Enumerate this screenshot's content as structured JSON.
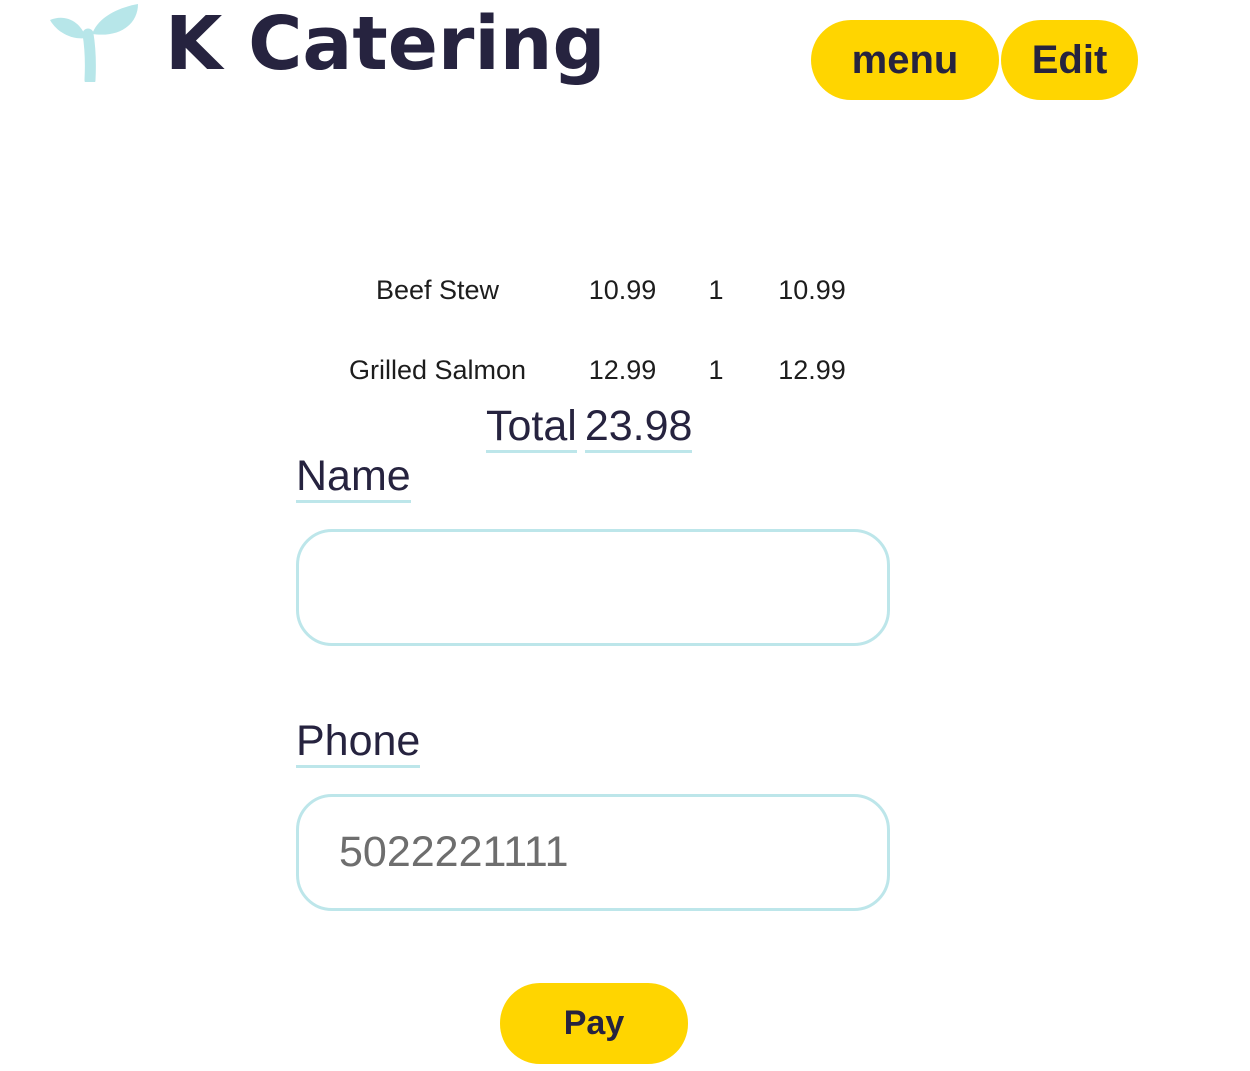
{
  "header": {
    "logo_icon": "sprout-icon",
    "title": "K Catering",
    "menu_label": "menu",
    "edit_label": "Edit"
  },
  "order": {
    "items": [
      {
        "name": "Beef Stew",
        "price": "10.99",
        "qty": "1",
        "subtotal": "10.99"
      },
      {
        "name": "Grilled Salmon",
        "price": "12.99",
        "qty": "1",
        "subtotal": "12.99"
      }
    ],
    "total_label": "Total",
    "total_value": "23.98"
  },
  "form": {
    "name_label": "Name",
    "name_value": "",
    "phone_label": "Phone",
    "phone_value": "5022221111",
    "pay_label": "Pay"
  },
  "colors": {
    "accent_yellow": "#ffd500",
    "text_dark": "#26233f",
    "border_teal": "#bde6ea",
    "logo_teal": "#b7e6e9"
  }
}
